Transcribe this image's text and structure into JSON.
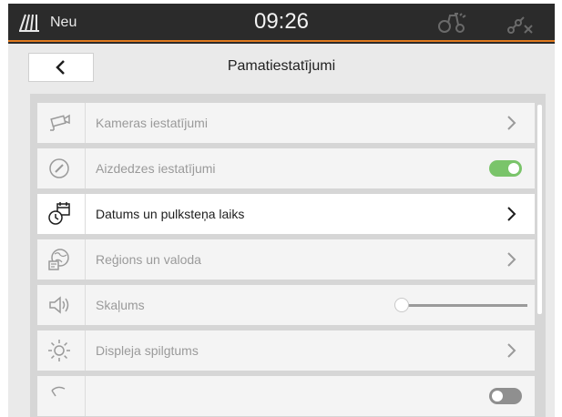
{
  "statusbar": {
    "app_label": "Neu",
    "time": "09:26",
    "app_icon": "field-icon",
    "tractor_icon": "tractor-icon",
    "gps_icon": "gps-no-signal-icon"
  },
  "header": {
    "title": "Pamatiestatījumi",
    "back_icon": "chevron-left-icon"
  },
  "settings": {
    "items": [
      {
        "label": "Kameras iestatījumi",
        "icon": "camera-icon",
        "control": "chevron",
        "enabled": false
      },
      {
        "label": "Aizdedzes iestatījumi",
        "icon": "ignition-icon",
        "control": "toggle",
        "value": true,
        "enabled": false
      },
      {
        "label": "Datums un pulksteņa laiks",
        "icon": "date-clock-icon",
        "control": "chevron",
        "enabled": true
      },
      {
        "label": "Reģions un valoda",
        "icon": "region-language-icon",
        "control": "chevron",
        "enabled": false
      },
      {
        "label": "Skaļums",
        "icon": "speaker-icon",
        "control": "slider",
        "value": 0,
        "enabled": false
      },
      {
        "label": "Displeja spilgtums",
        "icon": "brightness-icon",
        "control": "chevron",
        "enabled": false
      },
      {
        "label": "",
        "icon": "partial-icon",
        "control": "toggle",
        "value": false,
        "enabled": false
      }
    ]
  },
  "colors": {
    "accent": "#e07a1f",
    "toggle_on": "#7ac46a",
    "statusbar_bg": "#2b2b2b"
  }
}
